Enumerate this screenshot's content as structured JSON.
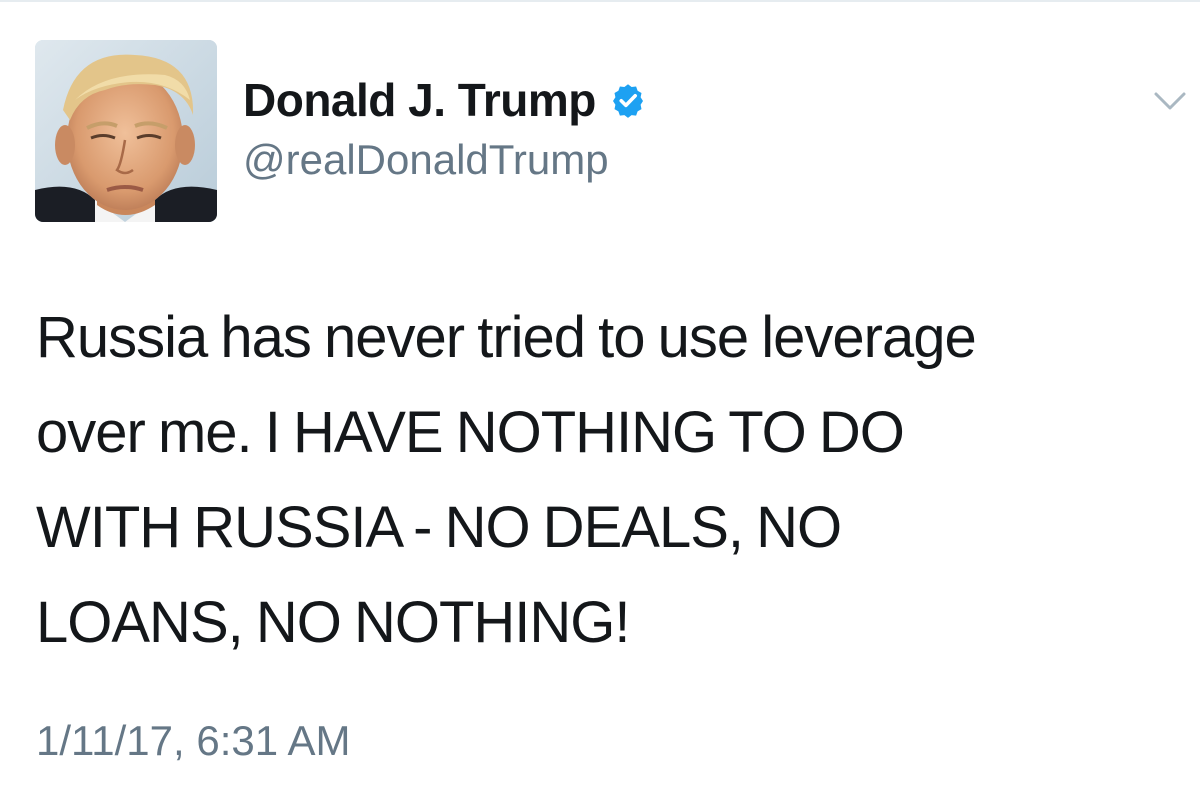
{
  "tweet": {
    "author": {
      "display_name": "Donald J. Trump",
      "handle": "@realDonaldTrump",
      "verified": true,
      "avatar_icon": "profile-photo"
    },
    "text_lines": [
      "Russia has never tried to use leverage",
      "over me. I HAVE NOTHING TO DO",
      "WITH RUSSIA - NO DEALS, NO",
      "LOANS, NO NOTHING!"
    ],
    "timestamp": "1/11/17, 6:31 AM",
    "menu_icon": "chevron-down-icon"
  },
  "colors": {
    "primary_text": "#14171a",
    "secondary_text": "#657786",
    "verified_blue": "#1da1f2",
    "divider": "#e6ecf0",
    "caret": "#aab8c2"
  }
}
